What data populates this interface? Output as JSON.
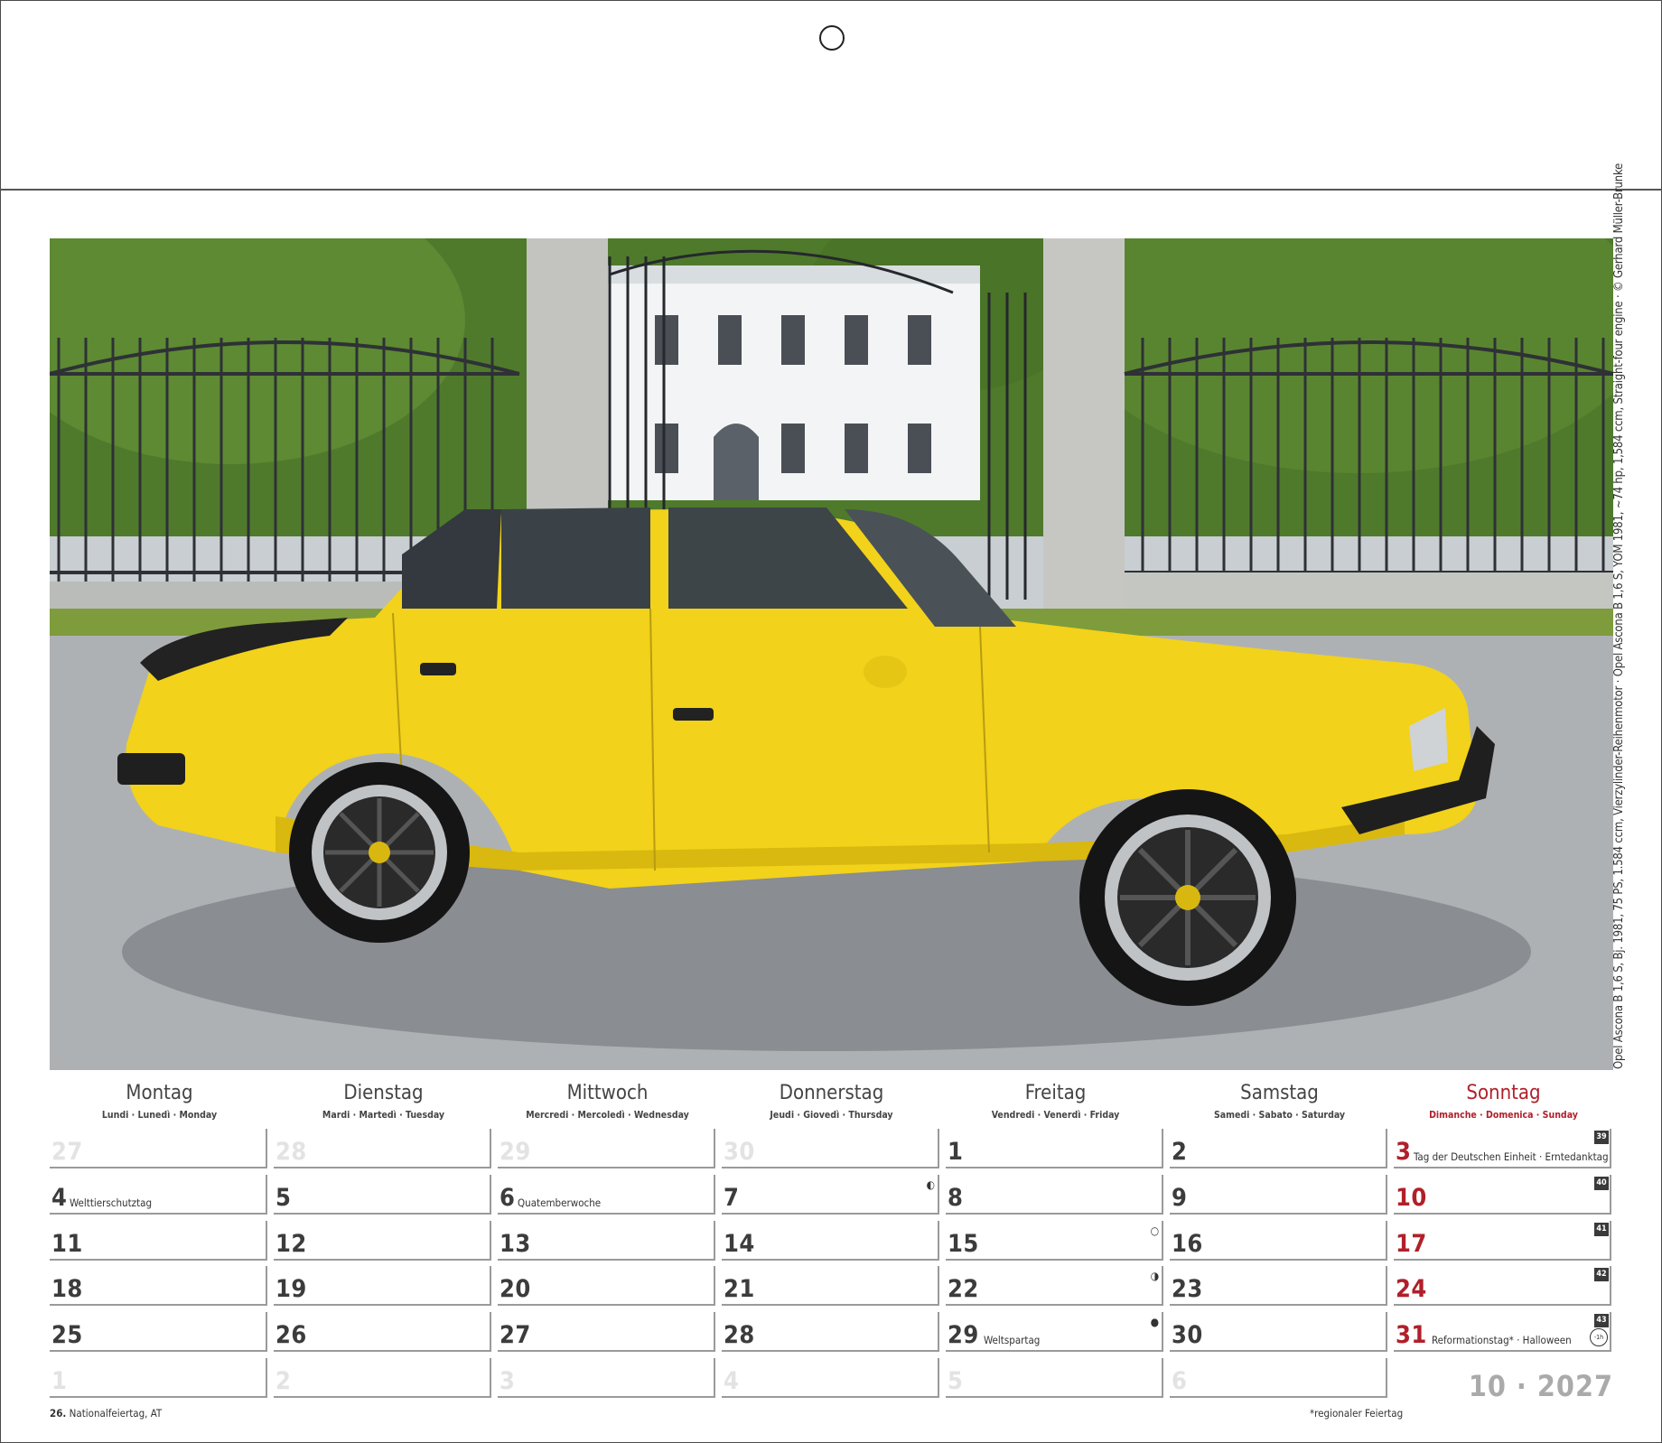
{
  "calendar": {
    "month_year": "10 · 2027",
    "photo_credit": "Opel Ascona B 1,6 S, Bj. 1981, 75 PS, 1.584 ccm, Vierzylinder-Reihenmotor · Opel Ascona B 1,6 S, YOM 1981, ~74 hp, 1,584 ccm, Straight-four engine · © Gerhard Müller-Brunke",
    "footnote_left_num": "26.",
    "footnote_left_text": " Nationalfeiertag, AT",
    "footnote_right": "*regionaler Feiertag",
    "days": [
      {
        "name": "Montag",
        "sub": "Lundi · Lunedì · Monday"
      },
      {
        "name": "Dienstag",
        "sub": "Mardi · Martedì · Tuesday"
      },
      {
        "name": "Mittwoch",
        "sub": "Mercredi · Mercoledì · Wednesday"
      },
      {
        "name": "Donnerstag",
        "sub": "Jeudi · Giovedì · Thursday"
      },
      {
        "name": "Freitag",
        "sub": "Vendredi · Venerdì · Friday"
      },
      {
        "name": "Samstag",
        "sub": "Samedi · Sabato · Saturday"
      },
      {
        "name": "Sonntag",
        "sub": "Dimanche · Domenica · Sunday"
      }
    ],
    "weeks": [
      {
        "kw": "39",
        "cells": [
          {
            "n": "27",
            "other": true
          },
          {
            "n": "28",
            "other": true
          },
          {
            "n": "29",
            "other": true
          },
          {
            "n": "30",
            "other": true
          },
          {
            "n": "1"
          },
          {
            "n": "2"
          },
          {
            "n": "3",
            "note": "Tag der Deutschen Einheit  ·  Erntedanktag"
          }
        ]
      },
      {
        "kw": "40",
        "cells": [
          {
            "n": "4",
            "note": "Welttierschutztag"
          },
          {
            "n": "5"
          },
          {
            "n": "6",
            "note": "Quatemberwoche"
          },
          {
            "n": "7",
            "moon": "◐"
          },
          {
            "n": "8"
          },
          {
            "n": "9"
          },
          {
            "n": "10"
          }
        ]
      },
      {
        "kw": "41",
        "cells": [
          {
            "n": "11"
          },
          {
            "n": "12"
          },
          {
            "n": "13"
          },
          {
            "n": "14"
          },
          {
            "n": "15",
            "moon": "○"
          },
          {
            "n": "16"
          },
          {
            "n": "17"
          }
        ]
      },
      {
        "kw": "42",
        "cells": [
          {
            "n": "18"
          },
          {
            "n": "19"
          },
          {
            "n": "20"
          },
          {
            "n": "21"
          },
          {
            "n": "22",
            "moon": "◑"
          },
          {
            "n": "23"
          },
          {
            "n": "24"
          }
        ]
      },
      {
        "kw": "43",
        "cells": [
          {
            "n": "25"
          },
          {
            "n": "26"
          },
          {
            "n": "27"
          },
          {
            "n": "28"
          },
          {
            "n": "29",
            "note": "Weltspartag",
            "moon": "●"
          },
          {
            "n": "30"
          },
          {
            "n": "31",
            "note": "Reformationstag*  ·  Halloween",
            "clock": "-1h"
          }
        ]
      },
      {
        "kw": "",
        "cells": [
          {
            "n": "1",
            "other": true
          },
          {
            "n": "2",
            "other": true
          },
          {
            "n": "3",
            "other": true
          },
          {
            "n": "4",
            "other": true
          },
          {
            "n": "5",
            "other": true
          },
          {
            "n": "6",
            "other": true
          }
        ]
      }
    ]
  },
  "colors": {
    "sunday": "#b0202a",
    "car": "#f2d21a",
    "other_month": "#e3e3e3"
  }
}
